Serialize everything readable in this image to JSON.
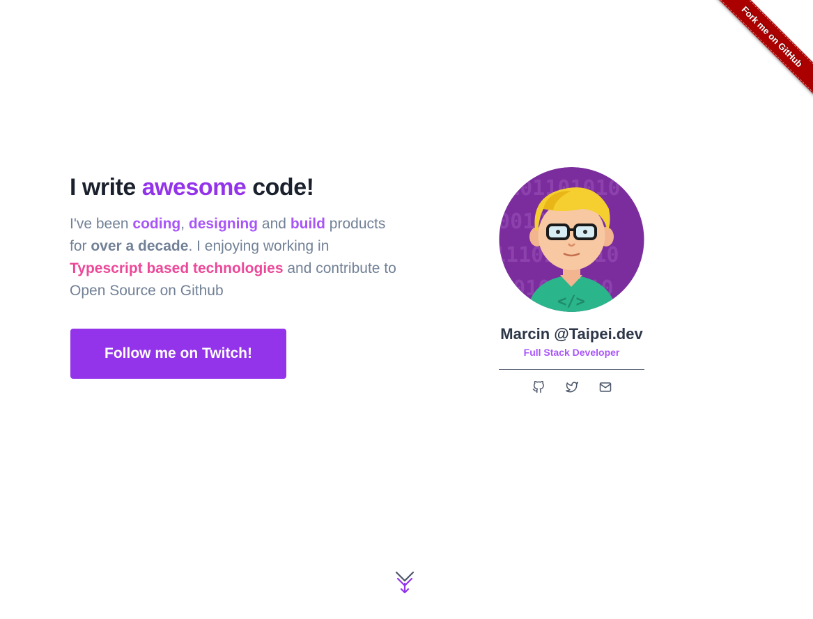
{
  "ribbon": {
    "label": "Fork me on GitHub",
    "color": "#aa0000"
  },
  "hero": {
    "title_part1": "I write ",
    "title_accent": "awesome",
    "title_part2": " code!",
    "text": {
      "t1": "I've been ",
      "coding": "coding",
      "t2": ", ",
      "designing": "designing",
      "t3": " and ",
      "build": "build",
      "t4": " products for ",
      "decade": "over a decade",
      "t5": ". I enjoying working in ",
      "typescript": "Typescript based technologies",
      "t6": " and contribute to Open Source on Github"
    },
    "cta_label": "Follow me on Twitch!"
  },
  "profile": {
    "name": "Marcin @Taipei.dev",
    "role": "Full Stack Developer",
    "avatar_background_text": "0101101010 1001001010 1110101010 0101010110",
    "social": [
      {
        "icon": "github-icon"
      },
      {
        "icon": "twitter-icon"
      },
      {
        "icon": "mail-icon"
      }
    ]
  },
  "colors": {
    "accent": "#9333ea",
    "accent_light": "#a855f7",
    "pink": "#ec4899",
    "heading": "#1a202c",
    "body_text": "#718096"
  },
  "scroll_icon": "chevrons-down-icon"
}
